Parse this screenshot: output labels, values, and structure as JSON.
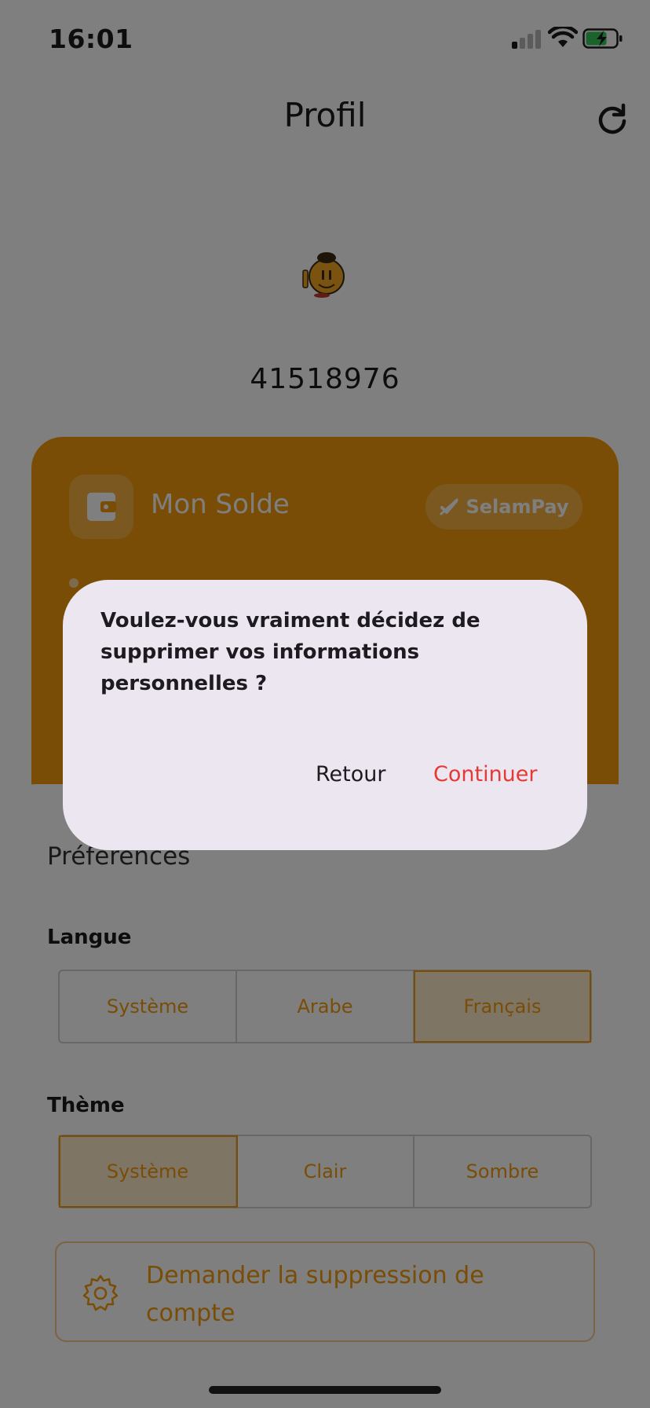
{
  "status_bar": {
    "time": "16:01"
  },
  "header": {
    "title": "Profil"
  },
  "profile": {
    "user_id": "41518976"
  },
  "balance_card": {
    "label": "Mon Solde",
    "badge": "SelamPay"
  },
  "preferences": {
    "title": "Préférences",
    "language": {
      "label": "Langue",
      "options": [
        "Système",
        "Arabe",
        "Français"
      ],
      "selected": "Français"
    },
    "theme": {
      "label": "Thème",
      "options": [
        "Système",
        "Clair",
        "Sombre"
      ],
      "selected": "Système"
    },
    "delete_account": "Demander la suppression de compte"
  },
  "dialog": {
    "message": "Voulez-vous vraiment décidez de supprimer vos informations personnelles ?",
    "back_label": "Retour",
    "continue_label": "Continuer"
  },
  "colors": {
    "accent": "#f39a0c",
    "danger": "#e53935",
    "dialog_bg": "#ece6f0"
  },
  "icons": [
    "refresh-icon",
    "wallet-icon",
    "selampay-logo-icon",
    "gear-icon",
    "signal-icon",
    "wifi-icon",
    "battery-icon"
  ]
}
